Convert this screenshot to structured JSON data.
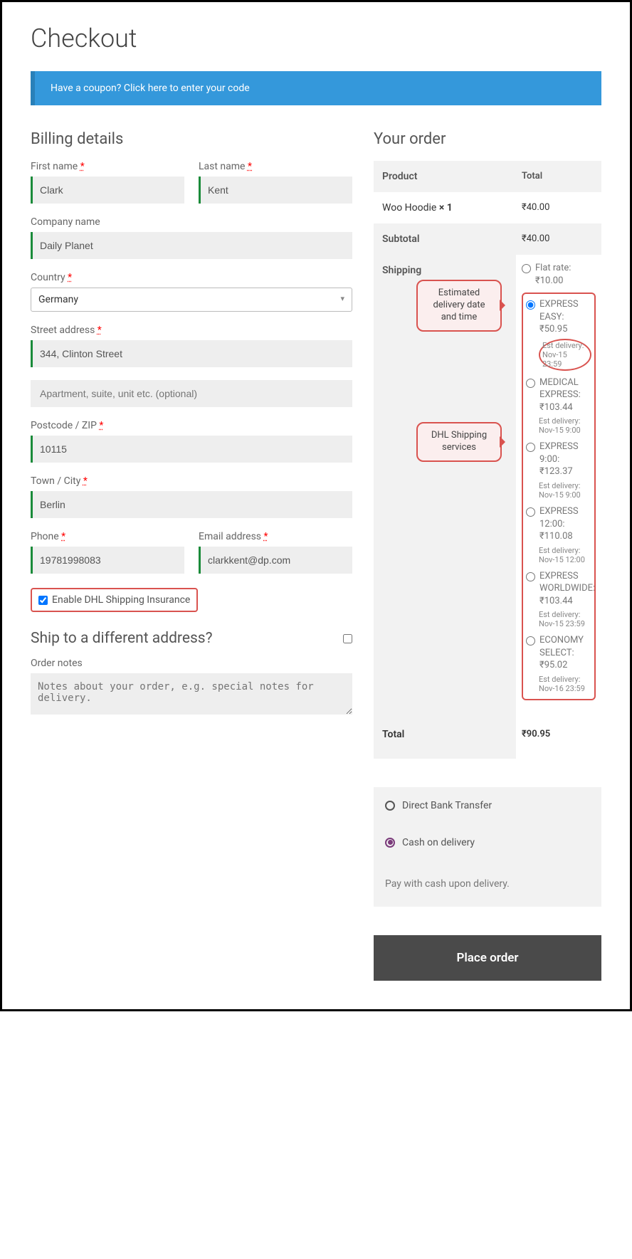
{
  "page_title": "Checkout",
  "coupon_prompt": "Have a coupon? Click here to enter your code",
  "billing": {
    "heading": "Billing details",
    "first_name_label": "First name",
    "first_name": "Clark",
    "last_name_label": "Last name",
    "last_name": "Kent",
    "company_label": "Company name",
    "company": "Daily Planet",
    "country_label": "Country",
    "country": "Germany",
    "street_label": "Street address",
    "street1": "344, Clinton Street",
    "street2_placeholder": "Apartment, suite, unit etc. (optional)",
    "postcode_label": "Postcode / ZIP",
    "postcode": "10115",
    "city_label": "Town / City",
    "city": "Berlin",
    "phone_label": "Phone",
    "phone": "19781998083",
    "email_label": "Email address",
    "email": "clarkkent@dp.com",
    "insurance_label": "Enable DHL Shipping Insurance"
  },
  "ship_diff_heading": "Ship to a different address?",
  "order_notes_label": "Order notes",
  "order_notes_placeholder": "Notes about your order, e.g. special notes for delivery.",
  "order": {
    "heading": "Your order",
    "col_product": "Product",
    "col_total": "Total",
    "item_name": "Woo Hoodie",
    "item_qty": "× 1",
    "item_total": "₹40.00",
    "subtotal_label": "Subtotal",
    "subtotal": "₹40.00",
    "shipping_label": "Shipping",
    "flat_rate": "Flat rate: ₹10.00",
    "opts": [
      {
        "label": "EXPRESS EASY: ₹50.95",
        "est": "Est delivery: Nov-15 23:59",
        "selected": true
      },
      {
        "label": "MEDICAL EXPRESS: ₹103.44",
        "est": "Est delivery: Nov-15 9:00",
        "selected": false
      },
      {
        "label": "EXPRESS 9:00: ₹123.37",
        "est": "Est delivery: Nov-15 9:00",
        "selected": false
      },
      {
        "label": "EXPRESS 12:00: ₹110.08",
        "est": "Est delivery: Nov-15 12:00",
        "selected": false
      },
      {
        "label": "EXPRESS WORLDWIDE: ₹103.44",
        "est": "Est delivery: Nov-15 23:59",
        "selected": false
      },
      {
        "label": "ECONOMY SELECT: ₹95.02",
        "est": "Est delivery: Nov-16 23:59",
        "selected": false
      }
    ],
    "total_label": "Total",
    "total": "₹90.95"
  },
  "callout_est": "Estimated delivery date and time",
  "callout_svc": "DHL Shipping services",
  "payment": {
    "bank": "Direct Bank Transfer",
    "cod": "Cash on delivery",
    "cod_desc": "Pay with cash upon delivery.",
    "place_order": "Place order"
  },
  "required_mark": "*"
}
